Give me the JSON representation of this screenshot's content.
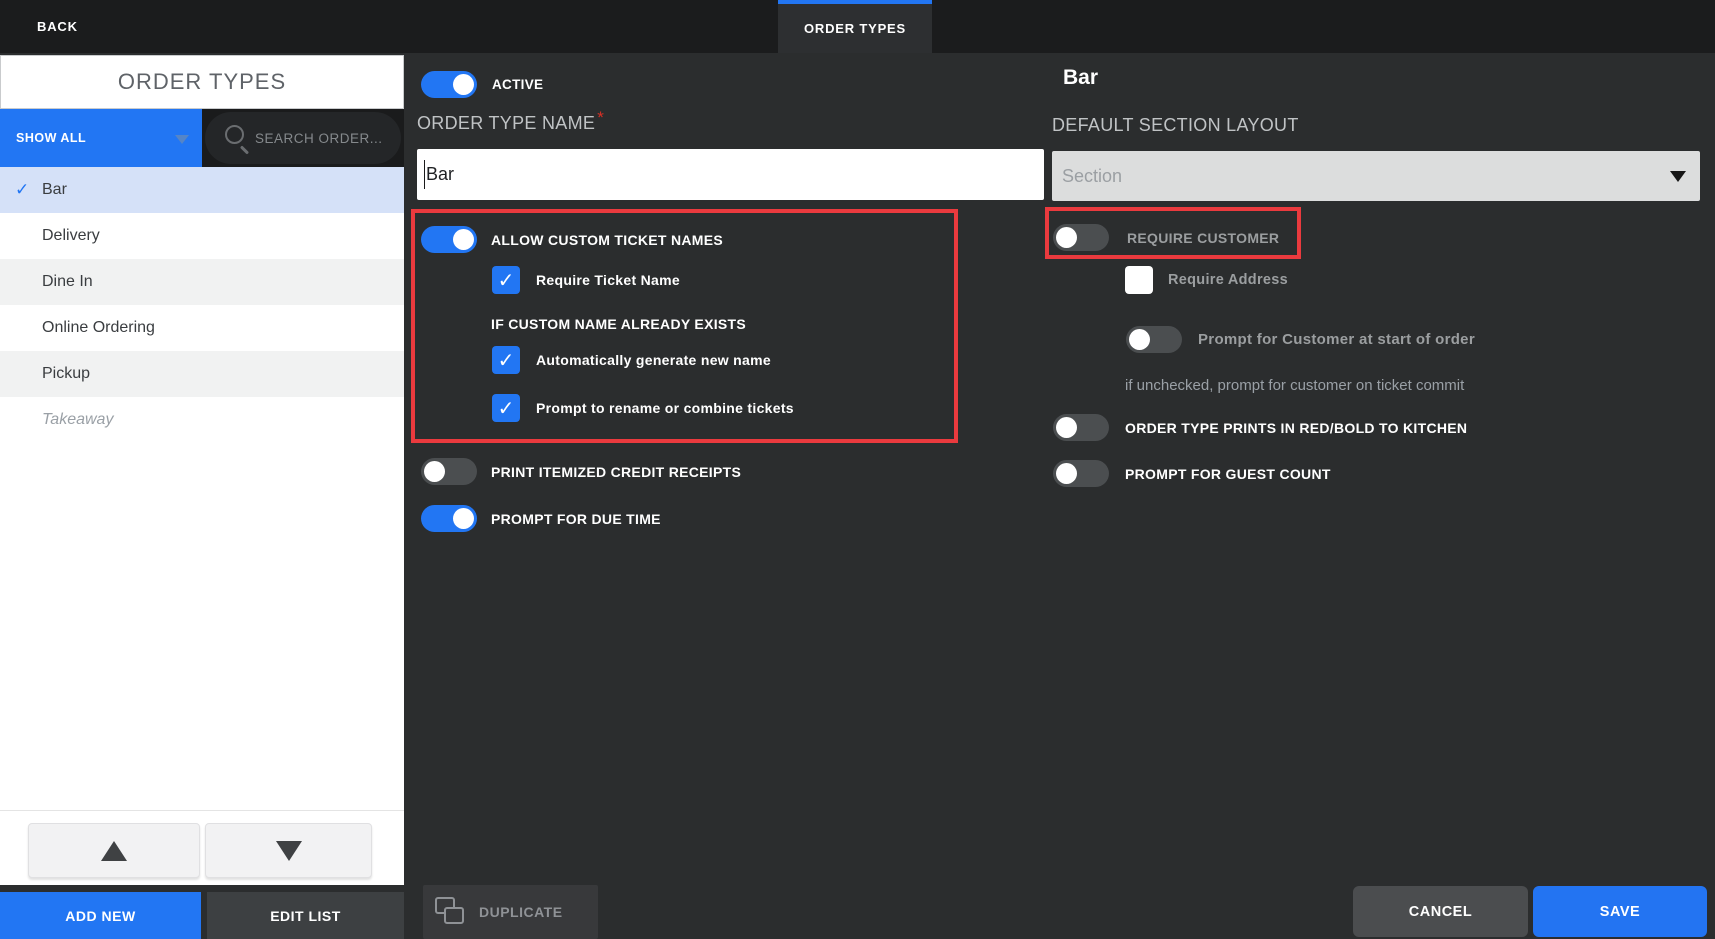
{
  "topbar": {
    "back_label": "BACK",
    "tab_label": "ORDER TYPES"
  },
  "sidebar": {
    "title": "ORDER TYPES",
    "filter": {
      "show_all_label": "SHOW ALL",
      "search_placeholder": "SEARCH ORDER..."
    },
    "items": [
      {
        "label": "Bar",
        "selected": true
      },
      {
        "label": "Delivery",
        "selected": false
      },
      {
        "label": "Dine In",
        "selected": false
      },
      {
        "label": "Online Ordering",
        "selected": false
      },
      {
        "label": "Pickup",
        "selected": false
      },
      {
        "label": "Takeaway",
        "selected": false,
        "inactive": true
      }
    ],
    "add_new_label": "ADD NEW",
    "edit_list_label": "EDIT LIST"
  },
  "form": {
    "active_label": "ACTIVE",
    "active_on": true,
    "name_label": "ORDER TYPE NAME",
    "name_required_mark": "*",
    "name_value": "Bar",
    "allow_custom_label": "ALLOW CUSTOM TICKET NAMES",
    "allow_custom_on": true,
    "require_ticket_name_label": "Require Ticket Name",
    "require_ticket_name_checked": true,
    "if_custom_exists_label": "IF CUSTOM NAME ALREADY EXISTS",
    "auto_generate_label": "Automatically generate new name",
    "auto_generate_checked": true,
    "prompt_rename_label": "Prompt to rename or combine tickets",
    "prompt_rename_checked": true,
    "print_itemized_label": "PRINT ITEMIZED CREDIT RECEIPTS",
    "print_itemized_on": false,
    "prompt_due_time_label": "PROMPT FOR DUE TIME",
    "prompt_due_time_on": true
  },
  "details": {
    "title": "Bar",
    "layout_label": "DEFAULT SECTION LAYOUT",
    "layout_placeholder": "Section",
    "require_customer_label": "REQUIRE CUSTOMER",
    "require_customer_on": false,
    "require_address_label": "Require Address",
    "require_address_checked": false,
    "prompt_customer_start_label": "Prompt for Customer at start of order",
    "prompt_customer_start_on": false,
    "unchecked_note": "if unchecked, prompt for customer on ticket commit",
    "prints_red_bold_label": "ORDER TYPE PRINTS IN RED/BOLD TO KITCHEN",
    "prints_red_bold_on": false,
    "prompt_guest_count_label": "PROMPT FOR GUEST COUNT",
    "prompt_guest_count_on": false
  },
  "actions": {
    "duplicate_label": "DUPLICATE",
    "cancel_label": "CANCEL",
    "save_label": "SAVE"
  },
  "icons": {
    "checkmark": "✓"
  },
  "colors": {
    "accent": "#2276f3",
    "save_blue": "#2374f2",
    "highlight_red": "#ea3a3e",
    "selected_row": "#d5e1f8",
    "background": "#2b2d2e",
    "topbar": "#1b1c1d"
  }
}
